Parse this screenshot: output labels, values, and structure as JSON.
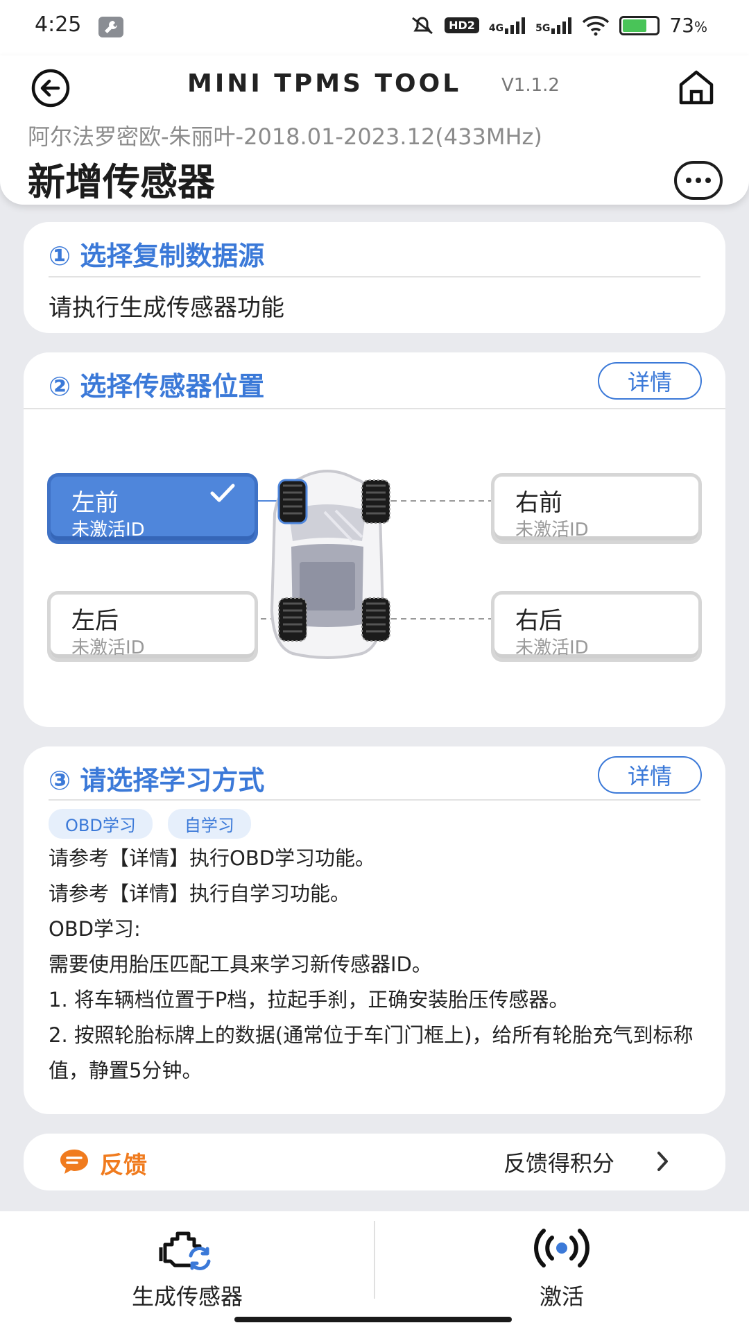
{
  "status_bar": {
    "time": "4:25",
    "network_badge": "HD2",
    "signal_1": "4G",
    "signal_2": "5G",
    "battery_percent": "73",
    "battery_unit": "%",
    "battery_level": 0.73,
    "icons": [
      "wrench-icon",
      "mute-icon",
      "signal-icon",
      "wifi-icon",
      "battery-icon"
    ]
  },
  "header": {
    "app_title": "MINI TPMS TOOL",
    "version": "V1.1.2",
    "vehicle": "阿尔法罗密欧-朱丽叶-2018.01-2023.12(433MHz)",
    "page_title": "新增传感器"
  },
  "step1": {
    "title": "① 选择复制数据源",
    "body": "请执行生成传感器功能"
  },
  "step2": {
    "title": "② 选择传感器位置",
    "detail_label": "详情",
    "positions": {
      "left_front": {
        "name": "左前",
        "status": "未激活ID",
        "selected": true
      },
      "right_front": {
        "name": "右前",
        "status": "未激活ID",
        "selected": false
      },
      "left_rear": {
        "name": "左后",
        "status": "未激活ID",
        "selected": false
      },
      "right_rear": {
        "name": "右后",
        "status": "未激活ID",
        "selected": false
      }
    }
  },
  "step3": {
    "title": "③ 请选择学习方式",
    "detail_label": "详情",
    "tags": [
      "OBD学习",
      "自学习"
    ],
    "lines": [
      "请参考【详情】执行OBD学习功能。",
      "请参考【详情】执行自学习功能。",
      "OBD学习:",
      "需要使用胎压匹配工具来学习新传感器ID。",
      "1. 将车辆档位置于P档，拉起手刹，正确安装胎压传感器。",
      "2. 按照轮胎标牌上的数据(通常位于车门门框上)，给所有轮胎充气到标称值，静置5分钟。"
    ]
  },
  "feedback": {
    "label": "反馈",
    "score_label": "反馈得积分"
  },
  "bottom_nav": {
    "generate_label": "生成传感器",
    "activate_label": "激活"
  },
  "colors": {
    "accent": "#3b79d8",
    "selected": "#4f86db",
    "feedback": "#f07b1e",
    "background": "#e9eaee"
  }
}
